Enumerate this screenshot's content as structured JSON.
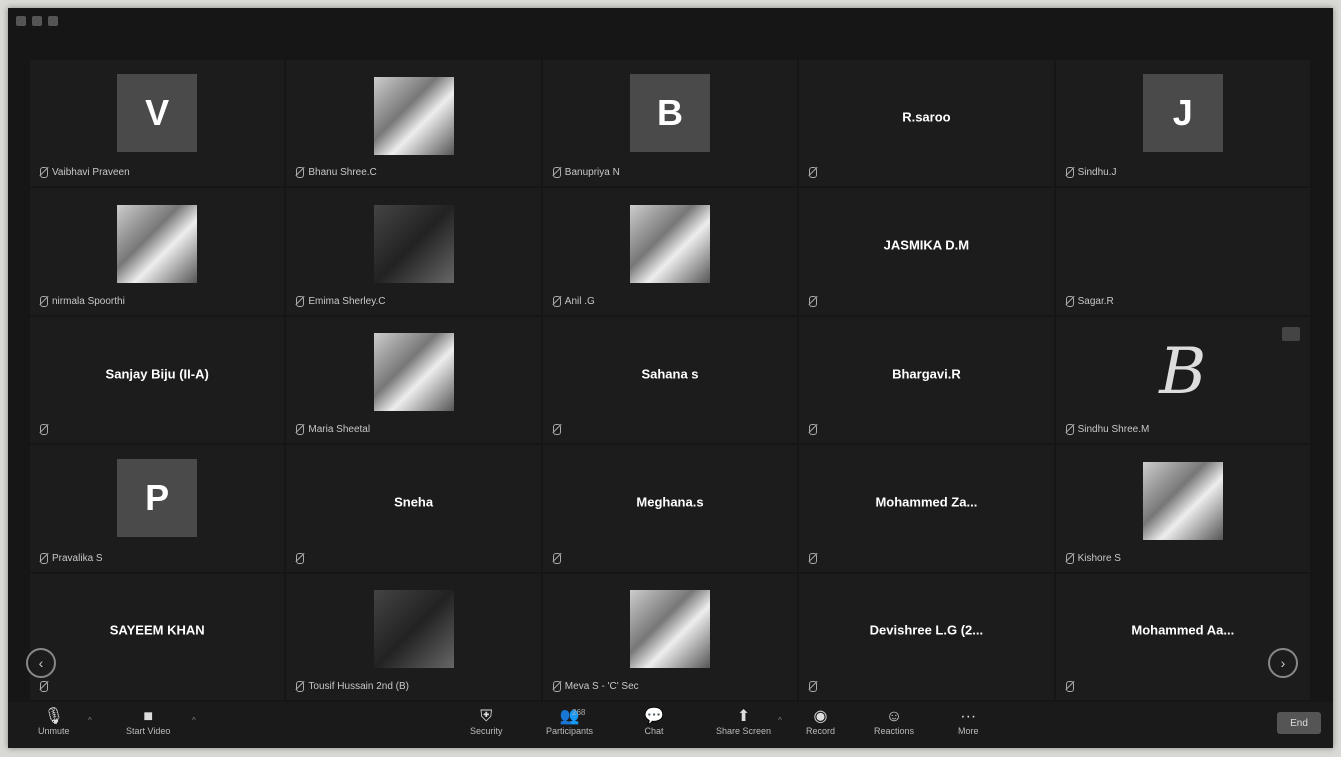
{
  "window": {
    "title": ""
  },
  "grid": {
    "tiles": [
      {
        "display": "letter",
        "letter": "V",
        "name": "Vaibhavi Praveen"
      },
      {
        "display": "photo",
        "name": "Bhanu Shree.C"
      },
      {
        "display": "letter",
        "letter": "B",
        "name": "Banupriya N"
      },
      {
        "display": "name",
        "center_name": "R.saroo",
        "name": ""
      },
      {
        "display": "letter",
        "letter": "J",
        "name": "Sindhu.J"
      },
      {
        "display": "photo",
        "name": "nirmala Spoorthi"
      },
      {
        "display": "photo-dark",
        "name": "Emima Sherley.C"
      },
      {
        "display": "photo",
        "name": "Anil .G"
      },
      {
        "display": "name",
        "center_name": "JASMIKA D.M",
        "name": ""
      },
      {
        "display": "blank",
        "name": "Sagar.R"
      },
      {
        "display": "name",
        "center_name": "Sanjay Biju (II-A)",
        "name": ""
      },
      {
        "display": "photo",
        "name": "Maria Sheetal"
      },
      {
        "display": "name",
        "center_name": "Sahana s",
        "name": ""
      },
      {
        "display": "name",
        "center_name": "Bhargavi.R",
        "name": ""
      },
      {
        "display": "pic-b",
        "letter": "B",
        "name": "Sindhu Shree.M"
      },
      {
        "display": "letter",
        "letter": "P",
        "name": "Pravalika S"
      },
      {
        "display": "name",
        "center_name": "Sneha",
        "name": ""
      },
      {
        "display": "name",
        "center_name": "Meghana.s",
        "name": ""
      },
      {
        "display": "name",
        "center_name": "Mohammed Za...",
        "name": ""
      },
      {
        "display": "photo",
        "name": "Kishore S"
      },
      {
        "display": "name",
        "center_name": "SAYEEM KHAN",
        "name": ""
      },
      {
        "display": "photo-dark",
        "name": "Tousif Hussain 2nd (B)"
      },
      {
        "display": "photo",
        "name": "Meva S - 'C' Sec"
      },
      {
        "display": "name",
        "center_name": "Devishree L.G (2...",
        "name": ""
      },
      {
        "display": "name",
        "center_name": "Mohammed Aa...",
        "name": ""
      }
    ]
  },
  "toolbar": {
    "unmute": "Unmute",
    "start_video": "Start Video",
    "security": "Security",
    "participants": "Participants",
    "participants_count": "268",
    "chat": "Chat",
    "share_screen": "Share Screen",
    "record": "Record",
    "reactions": "Reactions",
    "more": "More",
    "end": "End"
  },
  "icons": {
    "prev": "chevron-left-icon",
    "next": "chevron-right-icon"
  }
}
